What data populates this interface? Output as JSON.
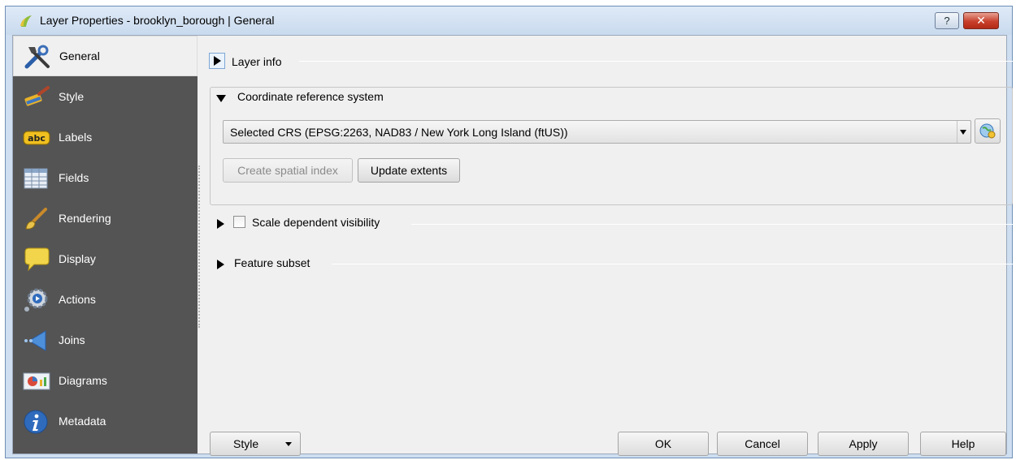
{
  "window": {
    "title": "Layer Properties - brooklyn_borough | General",
    "help_label": "?",
    "close_label": "✕"
  },
  "sidebar": {
    "items": [
      {
        "label": "General",
        "icon": "tools-icon",
        "selected": true
      },
      {
        "label": "Style",
        "icon": "paintbrush-icon",
        "selected": false
      },
      {
        "label": "Labels",
        "icon": "abc-label-icon",
        "selected": false
      },
      {
        "label": "Fields",
        "icon": "table-icon",
        "selected": false
      },
      {
        "label": "Rendering",
        "icon": "brush-icon",
        "selected": false
      },
      {
        "label": "Display",
        "icon": "speech-bubble-icon",
        "selected": false
      },
      {
        "label": "Actions",
        "icon": "gear-play-icon",
        "selected": false
      },
      {
        "label": "Joins",
        "icon": "join-icon",
        "selected": false
      },
      {
        "label": "Diagrams",
        "icon": "diagram-icon",
        "selected": false
      },
      {
        "label": "Metadata",
        "icon": "info-icon",
        "selected": false
      }
    ],
    "labels_badge": "abc"
  },
  "main": {
    "layer_info": {
      "label": "Layer info",
      "expanded": false
    },
    "crs": {
      "label": "Coordinate reference system",
      "expanded": true,
      "selected_value": "Selected CRS (EPSG:2263, NAD83 / New York Long Island (ftUS))",
      "create_index_label": "Create spatial index",
      "update_extents_label": "Update extents"
    },
    "scale_visibility": {
      "label": "Scale dependent visibility",
      "checked": false,
      "expanded": false
    },
    "feature_subset": {
      "label": "Feature subset",
      "expanded": false
    }
  },
  "footer": {
    "style_label": "Style",
    "ok_label": "OK",
    "cancel_label": "Cancel",
    "apply_label": "Apply",
    "help_label": "Help"
  },
  "colors": {
    "sidebar_bg": "#545454",
    "title_bar": "#cfdff1",
    "close_button": "#c8402c"
  }
}
